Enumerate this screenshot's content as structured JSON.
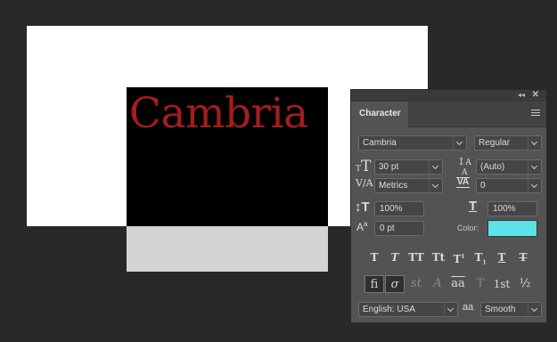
{
  "canvas": {
    "sample_text": "Cambria",
    "text_color": "#a51d1d"
  },
  "panel": {
    "tab_label": "Character",
    "font_family": "Cambria",
    "font_style": "Regular",
    "font_size": "30 pt",
    "leading": "(Auto)",
    "kerning": "Metrics",
    "tracking": "0",
    "vertical_scale": "100%",
    "horizontal_scale": "100%",
    "baseline_shift": "0 pt",
    "color_label": "Color:",
    "color_value": "#5de2e6",
    "language": "English: USA",
    "antialias_icon_label": "aa",
    "antialias": "Smooth",
    "style_buttons": [
      "T",
      "T",
      "TT",
      "Tt",
      "T",
      "T",
      "T",
      "T"
    ],
    "opentype_buttons": [
      "fi",
      "σ",
      "st",
      "A",
      "aa",
      "T",
      "1st",
      "½"
    ]
  },
  "icons": {
    "collapse": "double-chevron-left-icon",
    "close": "close-icon",
    "menu": "hamburger-menu-icon"
  }
}
